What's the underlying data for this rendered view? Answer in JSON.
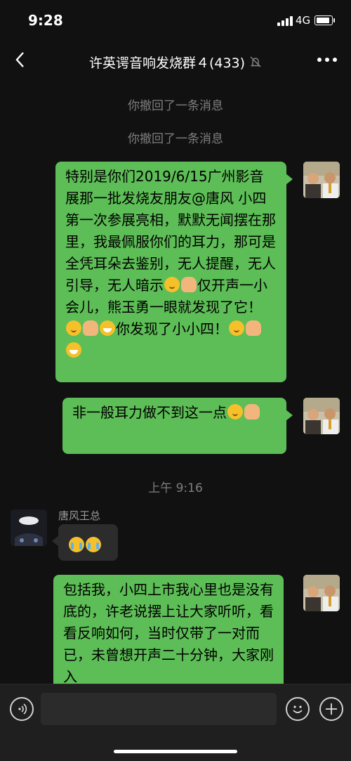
{
  "status_bar": {
    "time": "9:28",
    "network": "4G"
  },
  "header": {
    "title": "许英谔音响发烧群４(433)"
  },
  "system_messages": [
    "你撤回了一条消息",
    "你撤回了一条消息"
  ],
  "timestamp": "上午 9:16",
  "messages": [
    {
      "direction": "outgoing",
      "segments": [
        "特别是你们2019/6/15广州影音展那一批发烧友朋友@唐风 小四第一次参展亮相，默默无闻摆在那里，我最佩服你们的耳力，那可是全凭耳朵去鉴别，无人提醒，无人引导，无人暗示",
        "仅开声一小会儿，熊玉勇一眼就发现了它！",
        "你发现了小小四！"
      ],
      "emojis": [
        "hug-emoji",
        "thumbs-up-emoji",
        "grin-emoji"
      ]
    },
    {
      "direction": "outgoing",
      "segments": [
        "非一般耳力做不到这一点"
      ],
      "emojis": [
        "hug-emoji",
        "thumbs-up-emoji"
      ]
    },
    {
      "direction": "incoming",
      "sender": "唐风王总",
      "segments": [],
      "emojis": [
        "crying-laughing-emoji",
        "crying-laughing-emoji"
      ]
    },
    {
      "direction": "outgoing",
      "segments": [
        "包括我，小四上市我心里也是没有底的，许老说摆上让大家听听，看看反响如何，当时仅带了一对而已，未曾想开声二十分钟，大家刚入"
      ],
      "emojis": []
    }
  ],
  "colors": {
    "bubble_green": "#5dbd56",
    "background": "#111111",
    "bubble_gray": "#2c2c2c"
  }
}
